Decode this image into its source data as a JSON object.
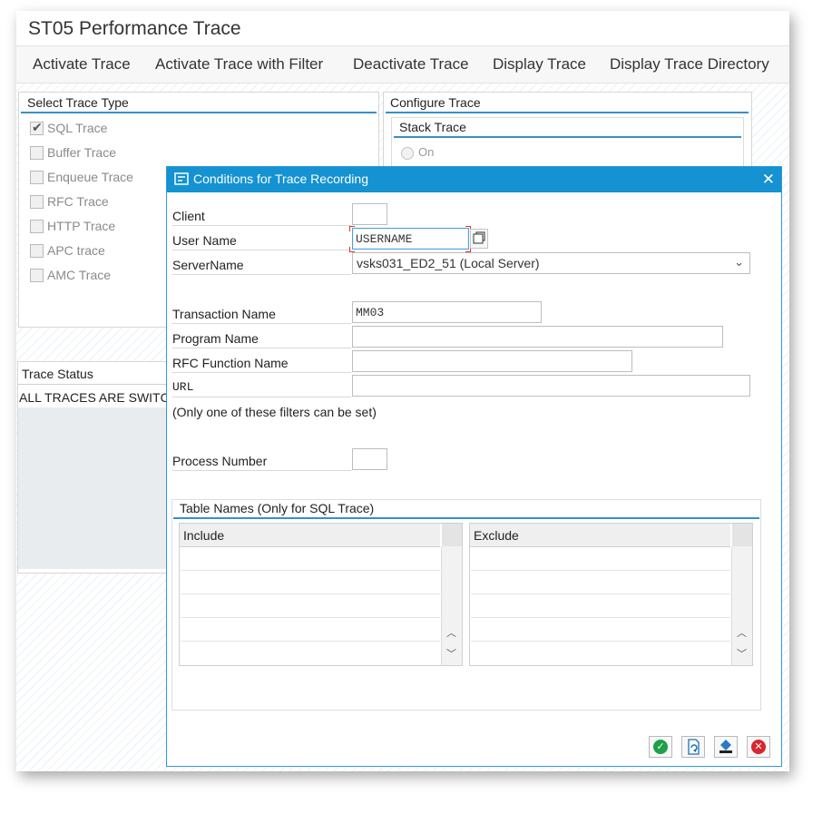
{
  "app": {
    "title": "ST05 Performance Trace"
  },
  "toolbar": {
    "activate": "Activate Trace",
    "activate_filter": "Activate Trace with Filter",
    "deactivate": "Deactivate Trace",
    "display": "Display Trace",
    "directory": "Display Trace Directory"
  },
  "trace_type": {
    "title": "Select Trace Type",
    "items": [
      {
        "label": "SQL Trace",
        "checked": true
      },
      {
        "label": "Buffer Trace",
        "checked": false
      },
      {
        "label": "Enqueue Trace",
        "checked": false
      },
      {
        "label": "RFC Trace",
        "checked": false
      },
      {
        "label": "HTTP Trace",
        "checked": false
      },
      {
        "label": "APC trace",
        "checked": false
      },
      {
        "label": "AMC Trace",
        "checked": false
      }
    ]
  },
  "configure": {
    "title": "Configure Trace",
    "stack_title": "Stack Trace",
    "on_label": "On"
  },
  "status": {
    "title": "Trace Status",
    "text": "ALL TRACES ARE SWITC"
  },
  "dialog": {
    "title": "Conditions for Trace Recording",
    "client_label": "Client",
    "client_value": "",
    "user_label": "User Name",
    "user_value": "USERNAME",
    "server_label": "ServerName",
    "server_value": "vsks031_ED2_51 (Local Server)",
    "transaction_label": "Transaction Name",
    "transaction_value": "MM03",
    "program_label": "Program Name",
    "program_value": "",
    "rfc_label": "RFC Function Name",
    "rfc_value": "",
    "url_label": "URL",
    "url_value": "",
    "note": "(Only one of these filters can be set)",
    "process_label": "Process Number",
    "process_value": "",
    "tables_title": "Table Names (Only for SQL Trace)",
    "include_header": "Include",
    "exclude_header": "Exclude"
  },
  "colors": {
    "accent": "#1492d1",
    "ok": "#1e9f4a",
    "cancel": "#d9262c"
  }
}
